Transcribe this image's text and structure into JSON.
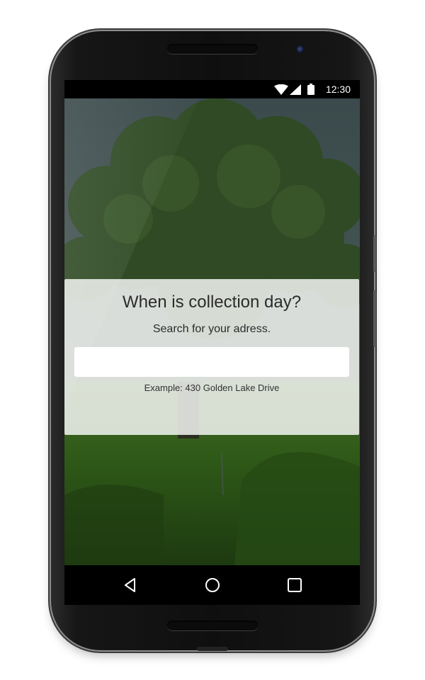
{
  "status_bar": {
    "time": "12:30",
    "icons": [
      "wifi-icon",
      "signal-icon",
      "battery-icon"
    ]
  },
  "collection": {
    "title": "When is collection day?",
    "subtitle": "Search for your adress.",
    "search_value": "",
    "search_placeholder": "",
    "example": "Example: 430 Golden Lake Drive"
  },
  "navigation": {
    "buttons": [
      "back-icon",
      "home-icon",
      "recents-icon"
    ]
  },
  "colors": {
    "card_background": "#eef0ec",
    "sky": "#3a4d4a",
    "foliage": "#2f4a22",
    "grass": "#2e5a18",
    "bar": "#000000"
  }
}
